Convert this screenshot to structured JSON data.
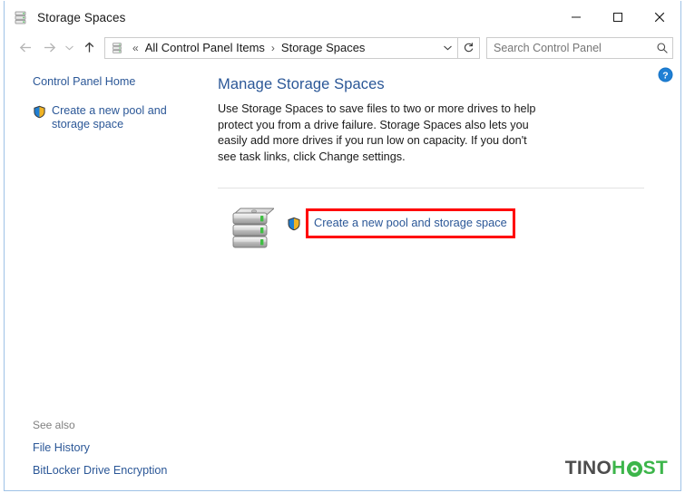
{
  "window": {
    "title": "Storage Spaces",
    "title_icon": "storage-drive-icon",
    "minimize_label": "Minimize",
    "maximize_label": "Maximize",
    "close_label": "Close"
  },
  "nav": {
    "back_icon": "back-arrow-icon",
    "forward_icon": "forward-arrow-icon",
    "recent_icon": "recent-locations-chevron-icon",
    "up_icon": "up-arrow-icon",
    "crumb_icon": "storage-drive-icon",
    "crumb_overflow": "«",
    "crumbs": [
      {
        "label": "All Control Panel Items"
      },
      {
        "label": "Storage Spaces"
      }
    ],
    "crumb_separator": "›",
    "dropdown_icon": "chevron-down-icon",
    "refresh_icon": "refresh-icon"
  },
  "search": {
    "placeholder": "Search Control Panel",
    "value": "",
    "icon": "search-icon"
  },
  "help": {
    "icon": "help-question-icon",
    "tooltip": "Help"
  },
  "sidebar": {
    "home_link": "Control Panel Home",
    "create_link": "Create a new pool and storage space",
    "create_shield_icon": "uac-shield-icon",
    "see_also_label": "See also",
    "see_also_links": [
      {
        "label": "File History"
      },
      {
        "label": "BitLocker Drive Encryption"
      }
    ]
  },
  "content": {
    "title": "Manage Storage Spaces",
    "description": "Use Storage Spaces to save files to two or more drives to help protect you from a drive failure. Storage Spaces also lets you easily add more drives if you run low on capacity. If you don't see task links, click Change settings.",
    "task_icon": "drive-stack-icon",
    "task_shield_icon": "uac-shield-icon",
    "task_link": "Create a new pool and storage space",
    "highlight_color": "#ff0000"
  },
  "watermark": {
    "part1": "TINO",
    "part2": "H",
    "part3": "ST",
    "color_dark": "#4d4d4d",
    "color_green": "#3cb54a"
  },
  "colors": {
    "link": "#2b5797",
    "window_border": "#9ec2e6",
    "divider": "#e2e2e2"
  }
}
